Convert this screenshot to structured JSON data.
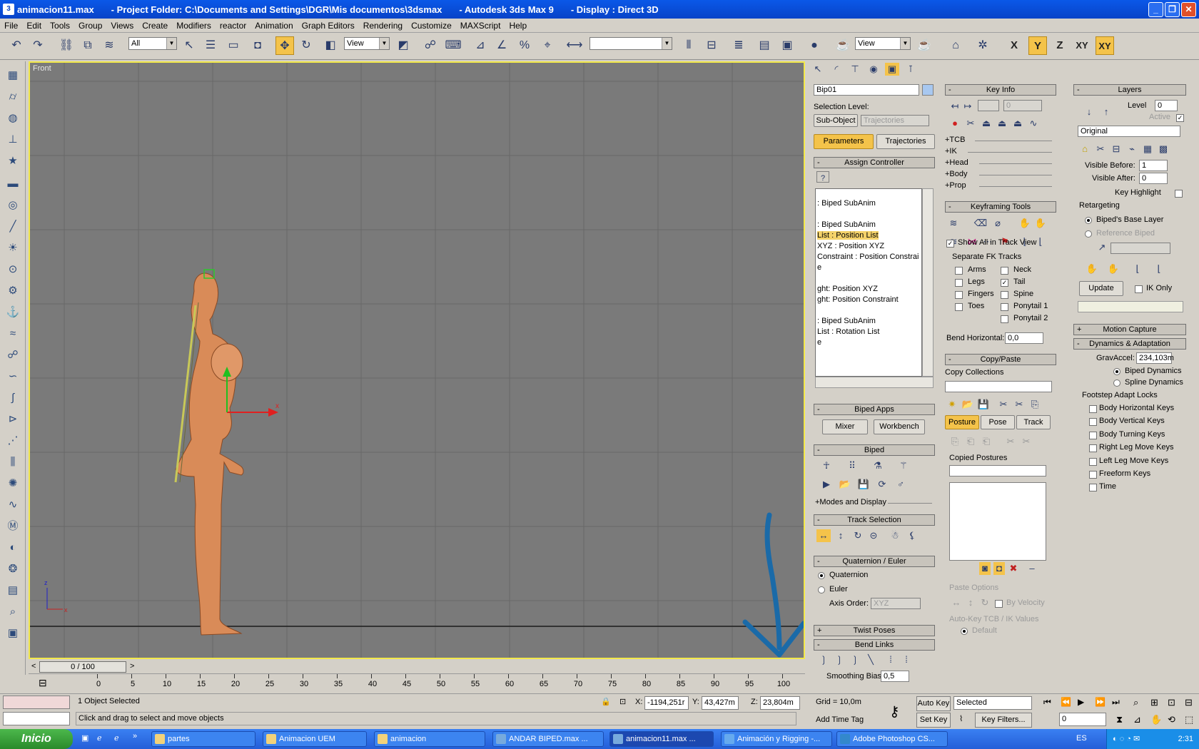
{
  "window": {
    "file": "animacion11.max",
    "project": "- Project Folder: C:\\Documents and Settings\\DGR\\Mis documentos\\3dsmax",
    "app": "- Autodesk 3ds Max 9",
    "display": "- Display : Direct 3D"
  },
  "menu": [
    "File",
    "Edit",
    "Tools",
    "Group",
    "Views",
    "Create",
    "Modifiers",
    "reactor",
    "Animation",
    "Graph Editors",
    "Rendering",
    "Customize",
    "MAXScript",
    "Help"
  ],
  "toolbar": {
    "filter_value": "All",
    "refcoord_value": "View",
    "named_sel_value": "",
    "render_view_value": "View",
    "axis": [
      "X",
      "Y",
      "Z",
      "XY",
      "XY"
    ]
  },
  "viewport": {
    "label": "Front",
    "axis_x": "x",
    "axis_z": "z",
    "gizmo_x": "x"
  },
  "timeline": {
    "slider": "0 / 100",
    "ticks": [
      "0",
      "5",
      "10",
      "15",
      "20",
      "25",
      "30",
      "35",
      "40",
      "45",
      "50",
      "55",
      "60",
      "65",
      "70",
      "75",
      "80",
      "85",
      "90",
      "95",
      "100"
    ]
  },
  "status": {
    "selected": "1 Object Selected",
    "prompt": "Click and drag to select and move objects",
    "x_label": "X:",
    "x_value": "-1194,251r",
    "y_label": "Y:",
    "y_value": "43,427m",
    "z_label": "Z:",
    "z_value": "23,804m",
    "grid": "Grid = 10,0m",
    "add_time_tag": "Add Time Tag",
    "auto_key": "Auto Key",
    "set_key": "Set Key",
    "key_mode": "Selected",
    "key_filters": "Key Filters...",
    "frame": "0"
  },
  "cmdpanel": {
    "object_name": "Bip01",
    "selection_level": "Selection Level:",
    "sub_object": "Sub-Object",
    "trajectories_dd": "Trajectories",
    "tab_parameters": "Parameters",
    "tab_trajectories": "Trajectories",
    "assign_controller": "Assign Controller",
    "controller_items": [
      ": Biped SubAnim",
      "",
      ": Biped SubAnim",
      "List : Position List",
      "XYZ : Position XYZ",
      "Constraint : Position Constrai",
      "e",
      "",
      "ght: Position XYZ",
      "ght: Position Constraint",
      "",
      ": Biped SubAnim",
      "List : Rotation List",
      "e"
    ],
    "biped_apps": "Biped Apps",
    "mixer": "Mixer",
    "workbench": "Workbench",
    "biped": "Biped",
    "modes_display": "+Modes and Display",
    "track_selection": "Track Selection",
    "quat_euler": "Quaternion / Euler",
    "quaternion": "Quaternion",
    "euler": "Euler",
    "axis_order": "Axis Order:",
    "axis_order_value": "XYZ",
    "twist_poses": "Twist Poses",
    "bend_links": "Bend Links",
    "smoothing_bias": "Smoothing Bias:",
    "smoothing_value": "0,5"
  },
  "keyinfo": {
    "title": "Key Info",
    "key_value": "0",
    "rows": [
      "+TCB",
      "+IK",
      "+Head",
      "+Body",
      "+Prop"
    ]
  },
  "keyframing": {
    "title": "Keyframing Tools",
    "show_all": "Show All in Track View",
    "separate_fk": "Separate FK Tracks",
    "fk_left": [
      "Arms",
      "Legs",
      "Fingers",
      "Toes"
    ],
    "fk_right": [
      "Neck",
      "Tail",
      "Spine",
      "Ponytail 1",
      "Ponytail 2"
    ],
    "bend_horizontal": "Bend Horizontal:",
    "bend_value": "0,0"
  },
  "copypaste": {
    "title": "Copy/Paste",
    "copy_collections": "Copy Collections",
    "tabs": [
      "Posture",
      "Pose",
      "Track"
    ],
    "copied_postures": "Copied Postures",
    "paste_options": "Paste Options",
    "by_velocity": "By Velocity",
    "autokey_tcb": "Auto-Key TCB / IK Values",
    "default": "Default"
  },
  "layers": {
    "title": "Layers",
    "level_label": "Level",
    "level_value": "0",
    "active": "Active",
    "layer_name": "Original",
    "visible_before": "Visible Before:",
    "visible_before_value": "1",
    "visible_after": "Visible After:",
    "visible_after_value": "0",
    "key_highlight": "Key Highlight",
    "retargeting": "Retargeting",
    "bipeds_base": "Biped's Base Layer",
    "reference_biped": "Reference Biped",
    "update": "Update",
    "ik_only": "IK Only"
  },
  "motion_capture": "Motion Capture",
  "dynamics": {
    "title": "Dynamics & Adaptation",
    "gravaccel": "GravAccel:",
    "gravaccel_value": "234,103m",
    "biped_dyn": "Biped Dynamics",
    "spline_dyn": "Spline Dynamics",
    "footstep_locks": "Footstep Adapt Locks",
    "locks": [
      "Body Horizontal Keys",
      "Body Vertical Keys",
      "Body Turning Keys",
      "Right Leg Move Keys",
      "Left Leg Move Keys",
      "Freeform Keys",
      "Time"
    ]
  },
  "taskbar": {
    "start": "Inicio",
    "tasks": [
      "partes",
      "Animacion UEM",
      "animacion",
      "ANDAR BIPED.max ...",
      "animacion11.max ...",
      "Animación y Rigging -...",
      "Adobe Photoshop CS..."
    ],
    "lang": "ES",
    "clock": "2:31"
  },
  "colors": {
    "viewport_bg": "#7a7a7a",
    "active_border": "#f3e94a",
    "selected": "#f4c34a",
    "arrow": "#1a6aa8",
    "figure": "#d88a58"
  }
}
